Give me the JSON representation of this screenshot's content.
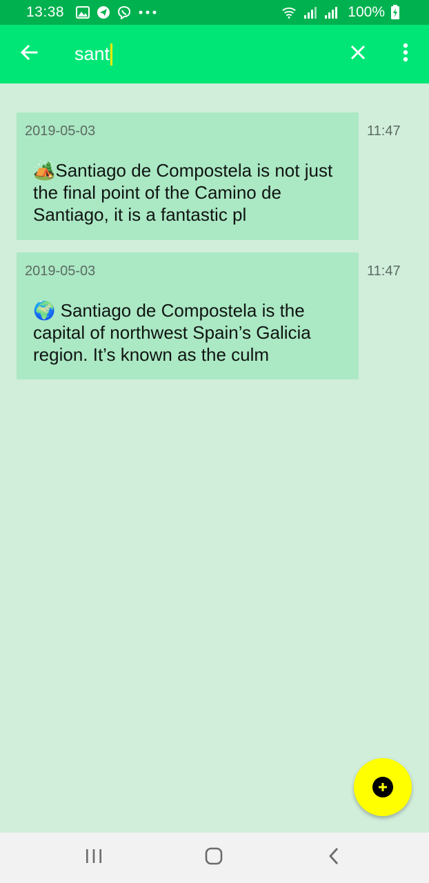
{
  "status_bar": {
    "time": "13:38",
    "battery": "100%",
    "icons": [
      "gallery-icon",
      "telegram-icon",
      "viber-icon",
      "more-dots-icon",
      "wifi-icon",
      "signal-icon",
      "signal-icon",
      "battery-charging-icon"
    ]
  },
  "search": {
    "query": "sant",
    "back_icon": "arrow-left-icon",
    "clear_icon": "close-icon",
    "menu_icon": "more-vert-icon"
  },
  "notes": [
    {
      "date": "2019-05-03",
      "time": "11:47",
      "text": "🏕️Santiago de Compostela is not just the final point of the Camino de Santiago, it is a fantastic pl"
    },
    {
      "date": "2019-05-03",
      "time": "11:47",
      "text": "🌍 Santiago de Compostela is the capital of northwest Spain’s Galicia region. It’s known as the culm"
    }
  ],
  "fab": {
    "icon": "add-circle-icon"
  },
  "nav_bar": {
    "icons": [
      "recent-apps-icon",
      "home-icon",
      "back-icon"
    ]
  },
  "colors": {
    "status_bar": "#00b14f",
    "app_bar": "#00e676",
    "background": "#d1eedb",
    "card": "#abe8c4",
    "fab": "#ffff00",
    "caret": "#ffeb00"
  }
}
